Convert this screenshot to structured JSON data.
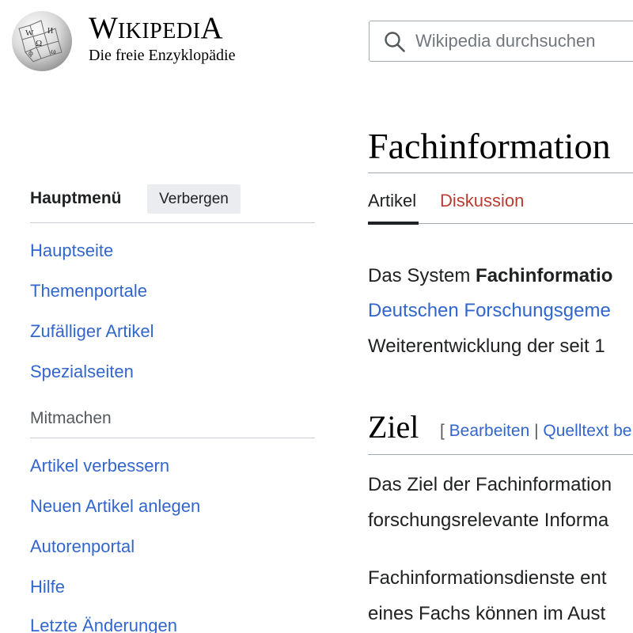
{
  "header": {
    "logo_icon": "wikipedia-globe-icon",
    "wordmark_first": "W",
    "wordmark_mid": "IKIPEDI",
    "wordmark_last": "A",
    "tagline": "Die freie Enzyklopädie",
    "search": {
      "icon": "search-icon",
      "placeholder": "Wikipedia durchsuchen"
    }
  },
  "sidebar": {
    "heading": "Hauptmenü",
    "hide_button": "Verbergen",
    "items": [
      {
        "label": "Hauptseite"
      },
      {
        "label": "Themenportale"
      },
      {
        "label": "Zufälliger Artikel"
      },
      {
        "label": "Spezialseiten"
      }
    ],
    "section_heading": "Mitmachen",
    "section_items": [
      {
        "label": "Artikel verbessern"
      },
      {
        "label": "Neuen Artikel anlegen"
      },
      {
        "label": "Autorenportal"
      },
      {
        "label": "Hilfe"
      },
      {
        "label": "Letzte Änderungen"
      }
    ]
  },
  "article": {
    "title": "Fachinformation",
    "tabs": [
      {
        "label": "Artikel",
        "selected": true
      },
      {
        "label": "Diskussion",
        "selected": false
      }
    ],
    "intro_line1_prefix": "Das System ",
    "intro_line1_bold": "Fachinformatio",
    "intro_line2_link": "Deutschen Forschungsgeme",
    "intro_line3": "Weiterentwicklung der seit 1",
    "section": {
      "heading": "Ziel",
      "edit_open": "[ ",
      "edit_link": "Bearbeiten",
      "edit_sep": " | ",
      "source_link": "Quelltext be"
    },
    "para1_line1": "Das Ziel der Fachinformation",
    "para1_line2": "forschungsrelevante Informa",
    "para2_line1": "Fachinformationsdienste ent",
    "para2_line2": "eines Fachs können im Aust"
  },
  "colors": {
    "link": "#3366cc",
    "talk_tab": "#ba3b30",
    "text": "#202122",
    "button_bg": "#eaecf0"
  }
}
